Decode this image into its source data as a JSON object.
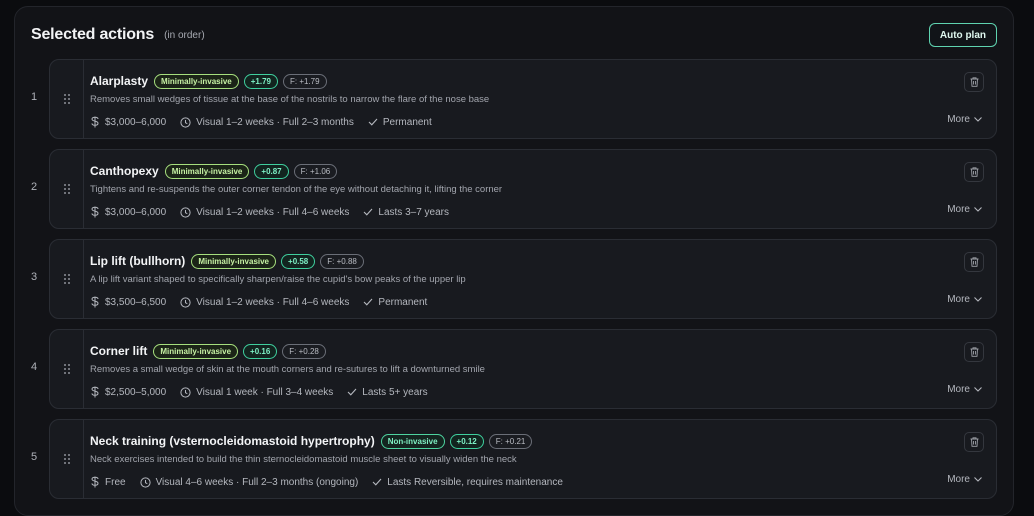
{
  "header": {
    "title": "Selected actions",
    "subtitle": "(in order)",
    "auto_plan_label": "Auto plan"
  },
  "actions": [
    {
      "index": "1",
      "name": "Alarplasty",
      "category": "Minimally-invasive",
      "delta": "+1.79",
      "f_score": "F: +1.79",
      "description": "Removes small wedges of tissue at the base of the nostrils to narrow the flare of the nose base",
      "cost": "$3,000–6,000",
      "recovery": "Visual 1–2 weeks · Full 2–3 months",
      "duration": "Permanent",
      "more_label": "More"
    },
    {
      "index": "2",
      "name": "Canthopexy",
      "category": "Minimally-invasive",
      "delta": "+0.87",
      "f_score": "F: +1.06",
      "description": "Tightens and re-suspends the outer corner tendon of the eye without detaching it, lifting the corner",
      "cost": "$3,000–6,000",
      "recovery": "Visual 1–2 weeks · Full 4–6 weeks",
      "duration": "Lasts 3–7 years",
      "more_label": "More"
    },
    {
      "index": "3",
      "name": "Lip lift (bullhorn)",
      "category": "Minimally-invasive",
      "delta": "+0.58",
      "f_score": "F: +0.88",
      "description": "A lip lift variant shaped to specifically sharpen/raise the cupid's bow peaks of the upper lip",
      "cost": "$3,500–6,500",
      "recovery": "Visual 1–2 weeks · Full 4–6 weeks",
      "duration": "Permanent",
      "more_label": "More"
    },
    {
      "index": "4",
      "name": "Corner lift",
      "category": "Minimally-invasive",
      "delta": "+0.16",
      "f_score": "F: +0.28",
      "description": "Removes a small wedge of skin at the mouth corners and re-sutures to lift a downturned smile",
      "cost": "$2,500–5,000",
      "recovery": "Visual 1 week · Full 3–4 weeks",
      "duration": "Lasts 5+ years",
      "more_label": "More"
    },
    {
      "index": "5",
      "name": "Neck training (vsternocleidomastoid hypertrophy)",
      "category": "Non-invasive",
      "delta": "+0.12",
      "f_score": "F: +0.21",
      "description": "Neck exercises intended to build the thin sternocleidomastoid muscle sheet to visually widen the neck",
      "cost": "Free",
      "recovery": "Visual 4–6 weeks · Full 2–3 months (ongoing)",
      "duration": "Lasts Reversible, requires maintenance",
      "more_label": "More"
    }
  ],
  "icons": {
    "cost": "dollar-icon",
    "recovery": "clock-icon",
    "duration": "check-icon",
    "delete": "trash-icon",
    "more": "chevron-down-icon",
    "drag": "drag-handle-icon"
  },
  "colors": {
    "accent": "#5fd3b0",
    "minimally_invasive": "#a6df7e",
    "non_invasive": "#4ed4a0",
    "delta": "#3fcf9e"
  }
}
